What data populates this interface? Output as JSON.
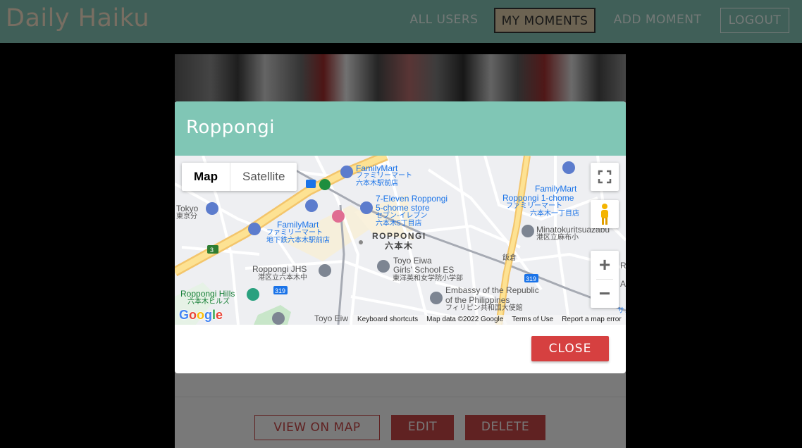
{
  "navbar": {
    "brand": "Daily Haiku",
    "links": [
      "ALL USERS",
      "MY MOMENTS",
      "ADD MOMENT",
      "LOGOUT"
    ]
  },
  "card": {
    "actions": {
      "view_on_map": "VIEW ON MAP",
      "edit": "EDIT",
      "delete": "DELETE"
    }
  },
  "modal": {
    "title": "Roppongi",
    "close_label": "CLOSE",
    "map": {
      "type_buttons": [
        "Map",
        "Satellite"
      ],
      "selected_type": "Map",
      "zoom_in": "+",
      "zoom_out": "−",
      "google_logo": "Google",
      "attribution": [
        "Keyboard shortcuts",
        "Map data ©2022 Google",
        "Terms of Use",
        "Report a map error"
      ],
      "labels": {
        "familymart_top": "FamilyMart",
        "familymart_top_jp": "ファミリーマート",
        "familymart_top_jp2": "六本木駅前店",
        "seven_eleven": "7-Eleven Roppongi",
        "seven_eleven2": "5-chome store",
        "seven_eleven_jp": "セブン-イレブン",
        "seven_eleven_jp2": "六本木5丁目店",
        "familymart_right": "FamilyMart",
        "familymart_right2": "Roppongi 1-chome",
        "familymart_right_jp": "ファミリーマート",
        "familymart_right_jp2": "六本木一丁目店",
        "tokyo": "Tokyo",
        "tokyo_jp": "東京分",
        "familymart_left": "FamilyMart",
        "familymart_left_jp": "ファミリーマート",
        "familymart_left_jp2": "地下鉄六本木駅前店",
        "roppongi_district": "ROPPONGI",
        "roppongi_district_jp": "六本木",
        "minatoku": "Minatokuritsuazabu",
        "minatoku_jp": "港区立麻布小",
        "iikura": "飯倉",
        "route3": "3",
        "route319a": "319",
        "route319b": "319",
        "roppongi_jhs": "Roppongi JHS",
        "roppongi_jhs_jp": "港区立六本木中",
        "toyo_eiwa": "Toyo Eiwa",
        "toyo_eiwa2": "Girls' School ES",
        "toyo_eiwa_jp": "東洋英和女学院小学部",
        "roppongi_hills": "Roppongi Hills",
        "roppongi_hills_jp": "六本木ヒルズ",
        "embassy": "Embassy of the Republic",
        "embassy2": "of the Philippines",
        "embassy_jp": "フィリピン共和国大使館",
        "toyo_eiw_bottom": "Toyo Eiw",
        "edge_a": "A",
        "edge_r": "R",
        "edge_sa": "サン"
      }
    }
  }
}
